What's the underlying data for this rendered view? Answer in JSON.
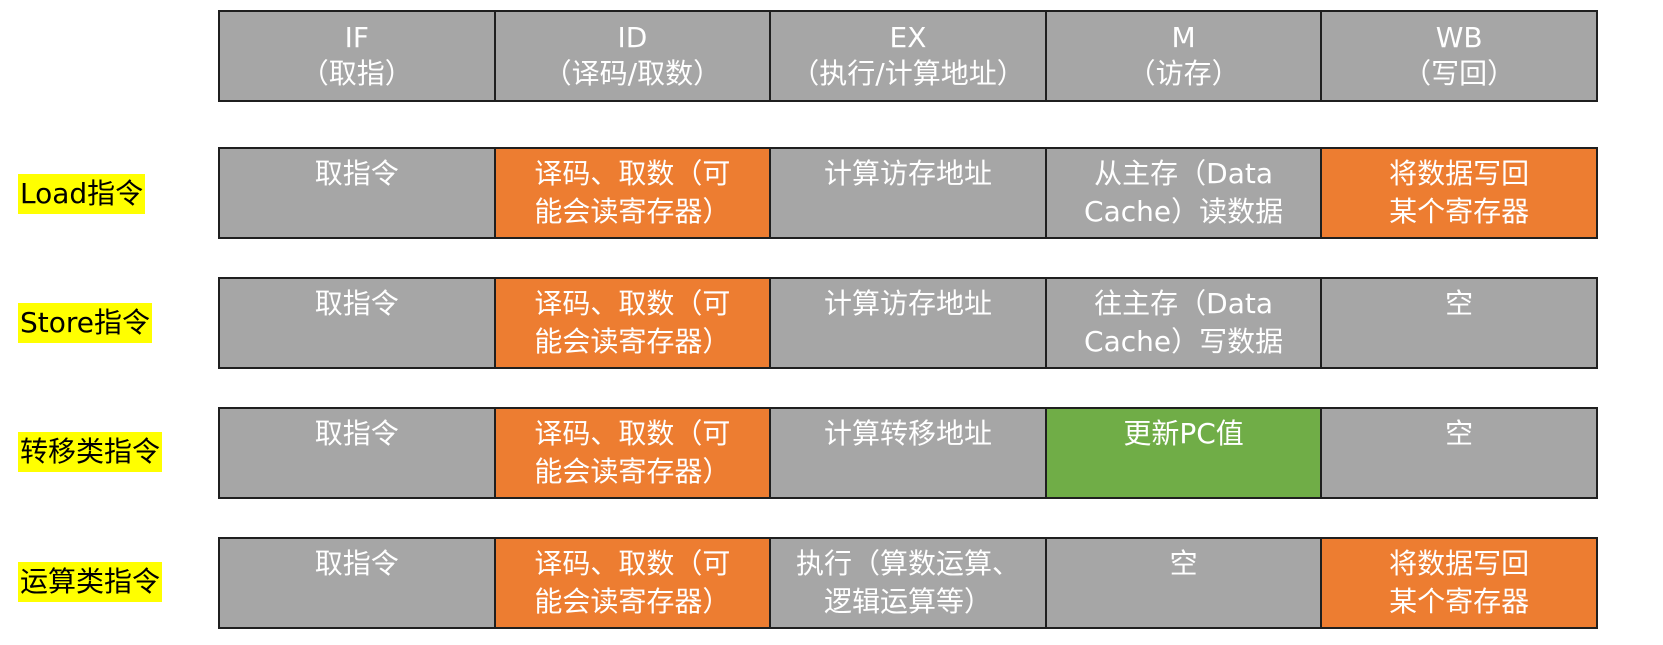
{
  "colors": {
    "cell_gray": "#a6a6a6",
    "cell_orange": "#ed7d31",
    "cell_green": "#70ad47",
    "label_highlight": "#ffff00"
  },
  "header": [
    {
      "stage": "IF",
      "desc": "（取指）"
    },
    {
      "stage": "ID",
      "desc": "（译码/取数）"
    },
    {
      "stage": "EX",
      "desc": "（执行/计算地址）"
    },
    {
      "stage": "M",
      "desc": "（访存）"
    },
    {
      "stage": "WB",
      "desc": "（写回）"
    }
  ],
  "rows": [
    {
      "label": "Load指令",
      "cells": [
        {
          "text": "取指令",
          "color": "gray"
        },
        {
          "text": "译码、取数（可\n能会读寄存器）",
          "color": "orange"
        },
        {
          "text": "计算访存地址",
          "color": "gray"
        },
        {
          "text": "从主存（Data\nCache）读数据",
          "color": "gray"
        },
        {
          "text": "将数据写回\n某个寄存器",
          "color": "orange"
        }
      ]
    },
    {
      "label": "Store指令",
      "cells": [
        {
          "text": "取指令",
          "color": "gray"
        },
        {
          "text": "译码、取数（可\n能会读寄存器）",
          "color": "orange"
        },
        {
          "text": "计算访存地址",
          "color": "gray"
        },
        {
          "text": "往主存（Data\nCache）写数据",
          "color": "gray"
        },
        {
          "text": "空",
          "color": "gray"
        }
      ]
    },
    {
      "label": "转移类指令",
      "cells": [
        {
          "text": "取指令",
          "color": "gray"
        },
        {
          "text": "译码、取数（可\n能会读寄存器）",
          "color": "orange"
        },
        {
          "text": "计算转移地址",
          "color": "gray"
        },
        {
          "text": "更新PC值",
          "color": "green"
        },
        {
          "text": "空",
          "color": "gray"
        }
      ]
    },
    {
      "label": "运算类指令",
      "cells": [
        {
          "text": "取指令",
          "color": "gray"
        },
        {
          "text": "译码、取数（可\n能会读寄存器）",
          "color": "orange"
        },
        {
          "text": "执行（算数运算、\n逻辑运算等）",
          "color": "gray"
        },
        {
          "text": "空",
          "color": "gray"
        },
        {
          "text": "将数据写回\n某个寄存器",
          "color": "orange"
        }
      ]
    }
  ]
}
